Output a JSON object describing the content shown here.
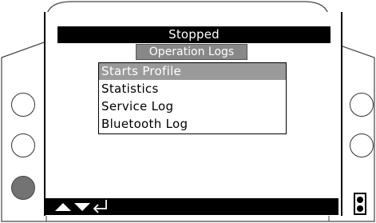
{
  "header": {
    "status": "Stopped",
    "menu_title": "Operation Logs"
  },
  "menu": {
    "items": [
      {
        "label": "Starts Profile",
        "selected": true
      },
      {
        "label": "Statistics",
        "selected": false
      },
      {
        "label": "Service Log",
        "selected": false
      },
      {
        "label": "Bluetooth Log",
        "selected": false
      }
    ]
  },
  "navigation": {
    "icons": [
      "up-arrow-icon",
      "down-arrow-icon",
      "enter-icon"
    ]
  },
  "side_buttons": {
    "left": [
      "button-outline",
      "button-outline",
      "button-filled"
    ],
    "right": [
      "button-outline",
      "button-outline"
    ]
  },
  "indicator": {
    "icon": "bluetooth-status-icon"
  },
  "colors": {
    "bar_black": "#000000",
    "selected_gray": "#9a9a9a",
    "subtitle_gray": "#888888",
    "button_fill": "#737373"
  }
}
